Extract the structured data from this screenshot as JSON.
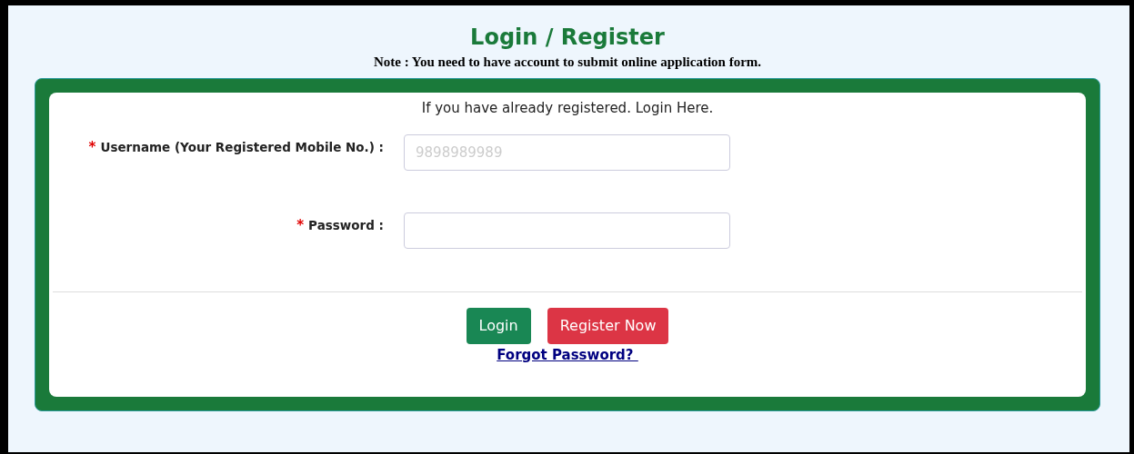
{
  "title": "Login / Register",
  "note": "Note : You need to have account to submit online application form.",
  "intro": "If you have already registered. Login Here.",
  "fields": [
    {
      "label": "Username (Your Registered Mobile No.) :",
      "required": true,
      "placeholder": "9898989989"
    },
    {
      "label": "Password :",
      "required": true
    }
  ],
  "required_mark": "*",
  "buttons": [
    {
      "label": "Login",
      "kind": "primary"
    },
    {
      "label": "Register Now",
      "kind": "danger"
    }
  ],
  "link": "Forgot Password? "
}
